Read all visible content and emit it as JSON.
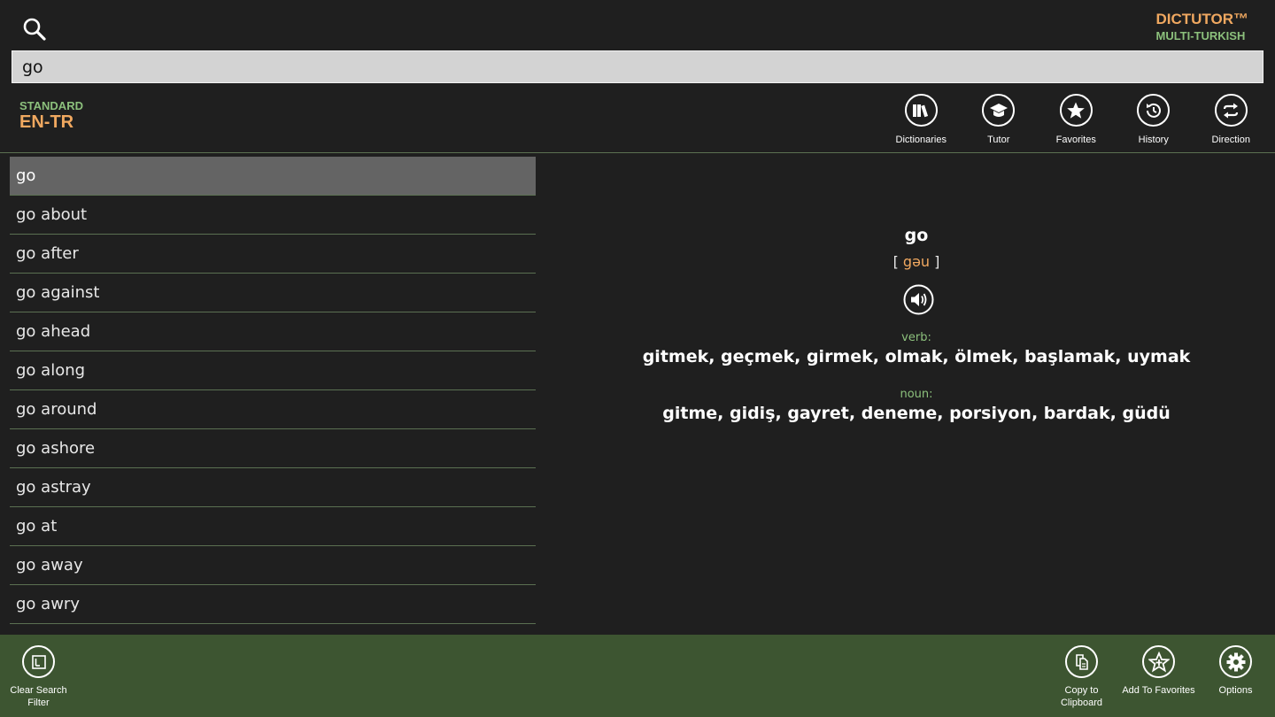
{
  "brand": {
    "name": "DICTUTOR™",
    "subtitle": "MULTI-TURKISH"
  },
  "search": {
    "value": "go"
  },
  "dictionary": {
    "mode": "STANDARD",
    "direction": "EN-TR"
  },
  "toolbar": {
    "dictionaries": "Dictionaries",
    "tutor": "Tutor",
    "favorites": "Favorites",
    "history": "History",
    "direction": "Direction"
  },
  "word_list": [
    "go",
    "go about",
    "go after",
    "go against",
    "go ahead",
    "go along",
    "go around",
    "go ashore",
    "go astray",
    "go at",
    "go away",
    "go awry"
  ],
  "definition": {
    "word": "go",
    "bracket_open": "[",
    "phonetic": "gəu",
    "bracket_close": "]",
    "verb_label": "verb:",
    "verb_meanings": "gitmek, geçmek, girmek, olmak, ölmek, başlamak, uymak",
    "noun_label": "noun:",
    "noun_meanings": "gitme, gidiş, gayret, deneme, porsiyon, bardak, güdü"
  },
  "appbar": {
    "clear_search_filter": "Clear Search Filter",
    "copy_to_clipboard": "Copy to Clipboard",
    "add_to_favorites": "Add To Favorites",
    "options": "Options"
  },
  "colors": {
    "background": "#1f1f1f",
    "accent_orange": "#f0a860",
    "accent_green": "#8cc07c",
    "appbar": "#3d5531",
    "selected_row": "#646464"
  }
}
